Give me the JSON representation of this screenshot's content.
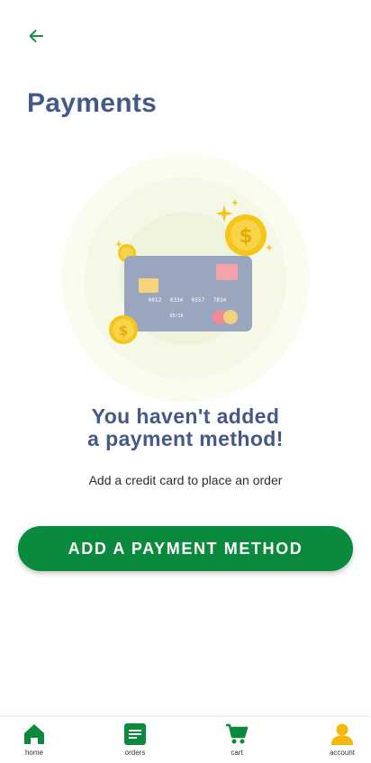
{
  "header": {
    "title": "Payments"
  },
  "empty_state": {
    "heading_line1": "You haven't added",
    "heading_line2": "a payment method!",
    "subtext": "Add a credit card to place an order",
    "card_number": [
      "0012",
      "0334",
      "0557",
      "7834"
    ],
    "card_expiry": "05/18"
  },
  "actions": {
    "add_label": "ADD A PAYMENT METHOD"
  },
  "nav": {
    "items": [
      {
        "label": "home",
        "icon": "home-icon"
      },
      {
        "label": "orders",
        "icon": "orders-icon"
      },
      {
        "label": "cart",
        "icon": "cart-icon"
      },
      {
        "label": "account",
        "icon": "account-icon"
      }
    ]
  },
  "colors": {
    "primary_green": "#0a8a3c",
    "title_blue": "#44598a",
    "accent_yellow": "#f5c518"
  }
}
